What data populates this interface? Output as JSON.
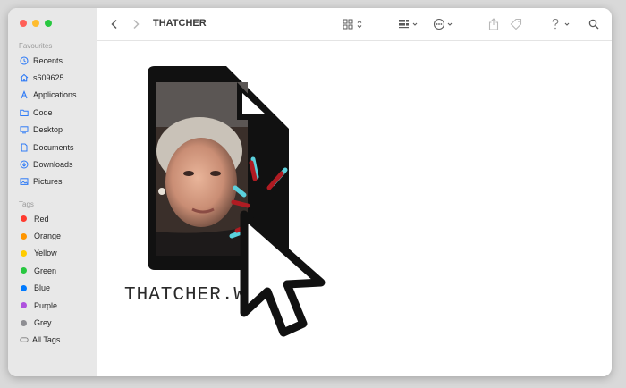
{
  "window": {
    "title": "THATCHER",
    "traffic_lights": [
      "#ff5f57",
      "#febc2e",
      "#28c840"
    ]
  },
  "sidebar": {
    "favourites_title": "Favourites",
    "favourites": [
      {
        "label": "Recents",
        "icon": "clock-icon"
      },
      {
        "label": "s609625",
        "icon": "home-icon"
      },
      {
        "label": "Applications",
        "icon": "applications-icon"
      },
      {
        "label": "Code",
        "icon": "folder-icon"
      },
      {
        "label": "Desktop",
        "icon": "desktop-icon"
      },
      {
        "label": "Documents",
        "icon": "document-icon"
      },
      {
        "label": "Downloads",
        "icon": "download-icon"
      },
      {
        "label": "Pictures",
        "icon": "pictures-icon"
      }
    ],
    "tags_title": "Tags",
    "tags": [
      {
        "label": "Red",
        "color": "#ff3b30"
      },
      {
        "label": "Orange",
        "color": "#ff9500"
      },
      {
        "label": "Yellow",
        "color": "#ffcc00"
      },
      {
        "label": "Green",
        "color": "#28c840"
      },
      {
        "label": "Blue",
        "color": "#007aff"
      },
      {
        "label": "Purple",
        "color": "#af52de"
      },
      {
        "label": "Grey",
        "color": "#8e8e93"
      },
      {
        "label": "All Tags...",
        "color": ""
      }
    ]
  },
  "toolbar": {
    "back_icon": "chevron-left-icon",
    "forward_icon": "chevron-right-icon",
    "view_icon": "grid-view-icon",
    "group_icon": "group-icon",
    "action_icon": "ellipsis-circle-icon",
    "share_icon": "share-icon",
    "tag_icon": "tag-icon",
    "help_icon": "question-icon",
    "search_icon": "search-icon"
  },
  "content": {
    "file_name": "THATCHER.W",
    "file_icon": "document-file-icon",
    "cursor_icon": "click-cursor-icon",
    "accent_colors": [
      "#b01b22",
      "#5bd0dc"
    ]
  }
}
